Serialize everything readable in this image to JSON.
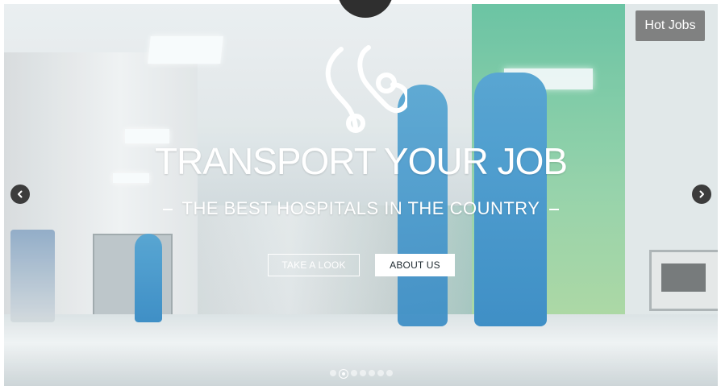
{
  "header": {
    "hot_jobs_label": "Hot Jobs"
  },
  "hero": {
    "title": "TRANSPORT YOUR JOB",
    "subtitle": "THE BEST HOSPITALS IN THE COUNTRY",
    "primary_button": "TAKE A LOOK",
    "secondary_button": "ABOUT US"
  },
  "slider": {
    "dot_count": 7,
    "active_index": 1
  },
  "icons": {
    "hero": "stethoscope-icon",
    "prev": "chevron-left-icon",
    "next": "chevron-right-icon"
  },
  "colors": {
    "arrow_bg": "#3c3c3c",
    "hot_jobs_bg": "#6e6e6e",
    "button_outline": "#ffffff",
    "button_solid_bg": "#ffffff"
  }
}
